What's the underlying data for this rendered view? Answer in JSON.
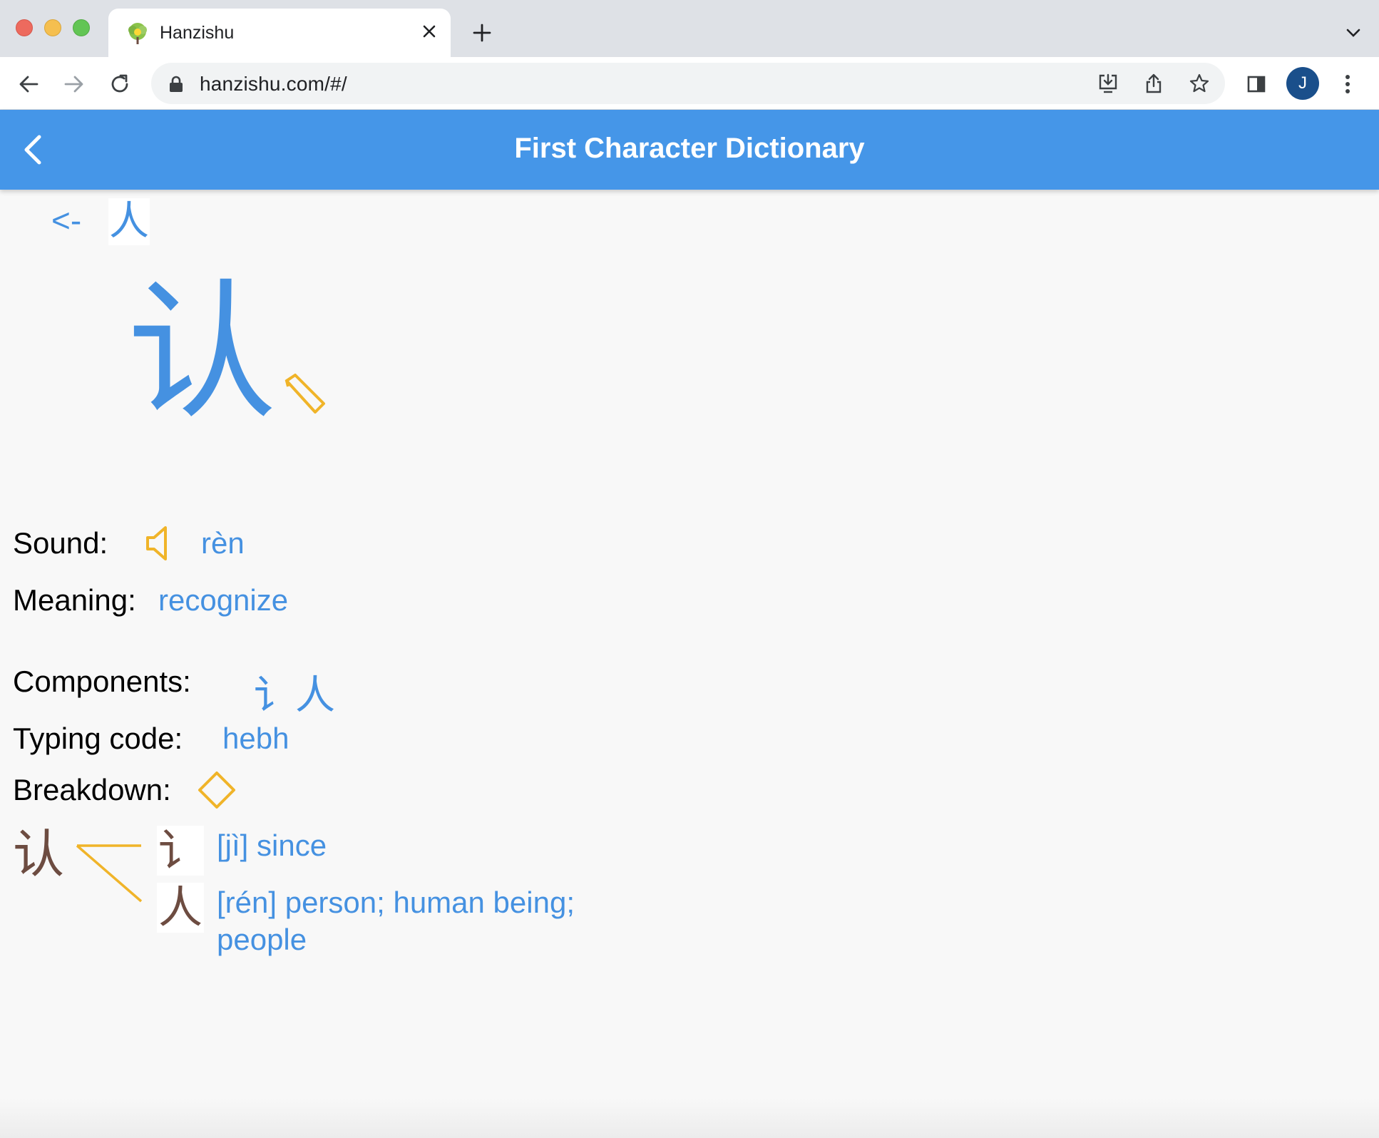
{
  "browser": {
    "tab_title": "Hanzishu",
    "url": "hanzishu.com/#/",
    "profile_initial": "J"
  },
  "app": {
    "title": "First Character Dictionary"
  },
  "nav": {
    "prev_arrow": "<-",
    "prev_char": "人"
  },
  "character": {
    "glyph": "认"
  },
  "details": {
    "sound_label": "Sound:",
    "sound_value": "rèn",
    "meaning_label": "Meaning:",
    "meaning_value": "recognize",
    "components_label": "Components:",
    "components": [
      "讠",
      "人"
    ],
    "typing_label": "Typing code:",
    "typing_value": "hebh",
    "breakdown_label": "Breakdown:"
  },
  "breakdown": {
    "main": "认",
    "parts": [
      {
        "char": "讠",
        "text": "[jì] since"
      },
      {
        "char": "人",
        "text": "[rén] person; human being; people"
      }
    ]
  },
  "colors": {
    "header_blue": "#4596e8",
    "char_blue": "#4591e1",
    "accent_yellow": "#f0b429",
    "breakdown_brown": "#6d4c41"
  }
}
